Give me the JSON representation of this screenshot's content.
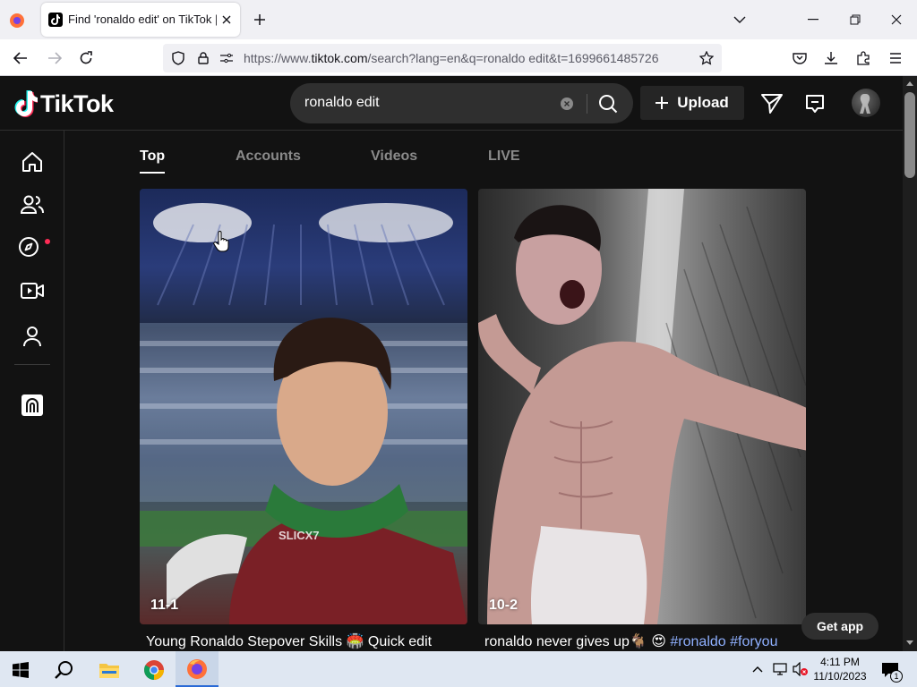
{
  "browser": {
    "tab_title": "Find 'ronaldo edit' on TikTok | T",
    "url_prefix": "https://www.",
    "url_host": "tiktok.com",
    "url_rest": "/search?lang=en&q=ronaldo edit&t=1699661485726"
  },
  "tiktok": {
    "logo_text": "TikTok",
    "search_value": "ronaldo edit",
    "upload_label": "Upload",
    "tabs": [
      {
        "label": "Top",
        "active": true
      },
      {
        "label": "Accounts",
        "active": false
      },
      {
        "label": "Videos",
        "active": false
      },
      {
        "label": "LIVE",
        "active": false
      }
    ],
    "sidenav": [
      {
        "icon": "home-icon"
      },
      {
        "icon": "friends-icon"
      },
      {
        "icon": "explore-icon"
      },
      {
        "icon": "live-icon"
      },
      {
        "icon": "profile-icon"
      },
      {
        "icon": "more-icon"
      }
    ],
    "videos": [
      {
        "count": "11-1",
        "watermark": "SLICX7",
        "caption": "Young Ronaldo Stepover Skills 🏟️ Quick edit",
        "hashtags": ""
      },
      {
        "count": "10-2",
        "watermark": "",
        "caption": "ronaldo never gives up🐐 😍",
        "hashtags": "#ronaldo #foryou"
      }
    ],
    "get_app_label": "Get app"
  },
  "taskbar": {
    "time": "4:11 PM",
    "date": "11/10/2023",
    "notification_count": "1"
  }
}
